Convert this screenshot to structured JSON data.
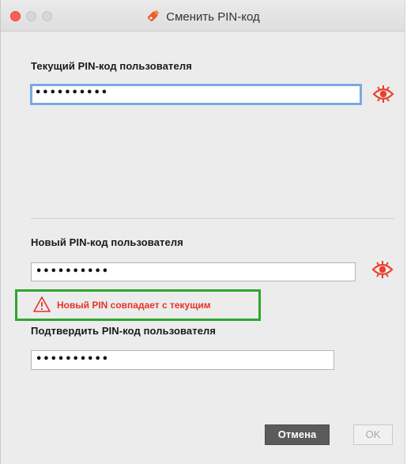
{
  "window": {
    "title": "Сменить PIN-код",
    "title_icon": "usb-token-icon"
  },
  "current_pin": {
    "label": "Текущий PIN-код пользователя",
    "value": "••••••••••",
    "show_icon": "eye-icon"
  },
  "new_pin": {
    "label": "Новый PIN-код пользователя",
    "value": "••••••••••",
    "show_icon": "eye-icon"
  },
  "warning": {
    "text": "Новый PIN совпадает с текущим",
    "icon": "warning-triangle-icon"
  },
  "confirm_pin": {
    "label": "Подтвердить PIN-код пользователя",
    "value": "••••••••••"
  },
  "buttons": {
    "cancel": "Отмена",
    "ok": "OK"
  },
  "colors": {
    "accent_error": "#e5332a",
    "highlight_box": "#2fa531",
    "focus_ring": "#7aa9e4"
  }
}
